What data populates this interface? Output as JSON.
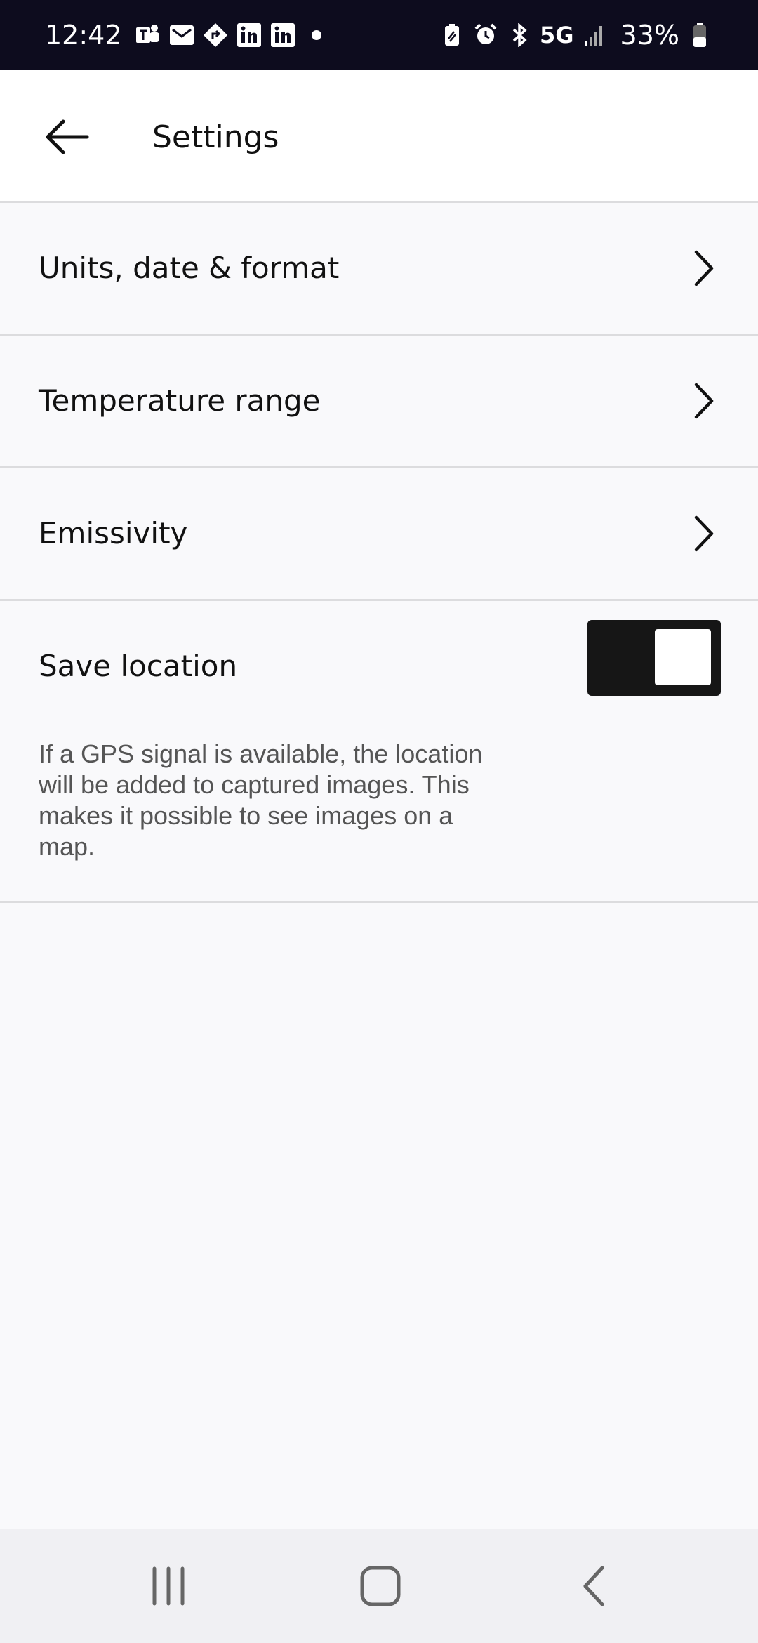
{
  "status_bar": {
    "time": "12:42",
    "network": "5G",
    "battery": "33%",
    "left_icons": [
      "teams-icon",
      "mail-icon",
      "directions-icon",
      "linkedin-icon",
      "linkedin-icon"
    ],
    "right_icons": [
      "battery-saver-icon",
      "alarm-icon",
      "bluetooth-icon",
      "signal-icon",
      "battery-icon"
    ]
  },
  "header": {
    "title": "Settings",
    "back_icon": "arrow-left-icon"
  },
  "settings": {
    "items": [
      {
        "label": "Units, date & format",
        "icon": "chevron-right-icon"
      },
      {
        "label": "Temperature range",
        "icon": "chevron-right-icon"
      },
      {
        "label": "Emissivity",
        "icon": "chevron-right-icon"
      }
    ],
    "save_location": {
      "label": "Save location",
      "enabled": true,
      "description": "If a GPS signal is available, the location will be added to captured images. This makes it possible to see images on a map."
    }
  },
  "nav_bar": {
    "recents_icon": "recents-icon",
    "home_icon": "home-icon",
    "back_icon": "back-icon"
  },
  "colors": {
    "status_bar_bg": "#0d0c1e",
    "page_bg": "#f9f9fb",
    "header_bg": "#ffffff",
    "divider": "#dcdcde",
    "toggle_on": "#161616",
    "text_primary": "#111111",
    "text_secondary": "#555555",
    "nav_bar_bg": "#f0f0f3"
  }
}
